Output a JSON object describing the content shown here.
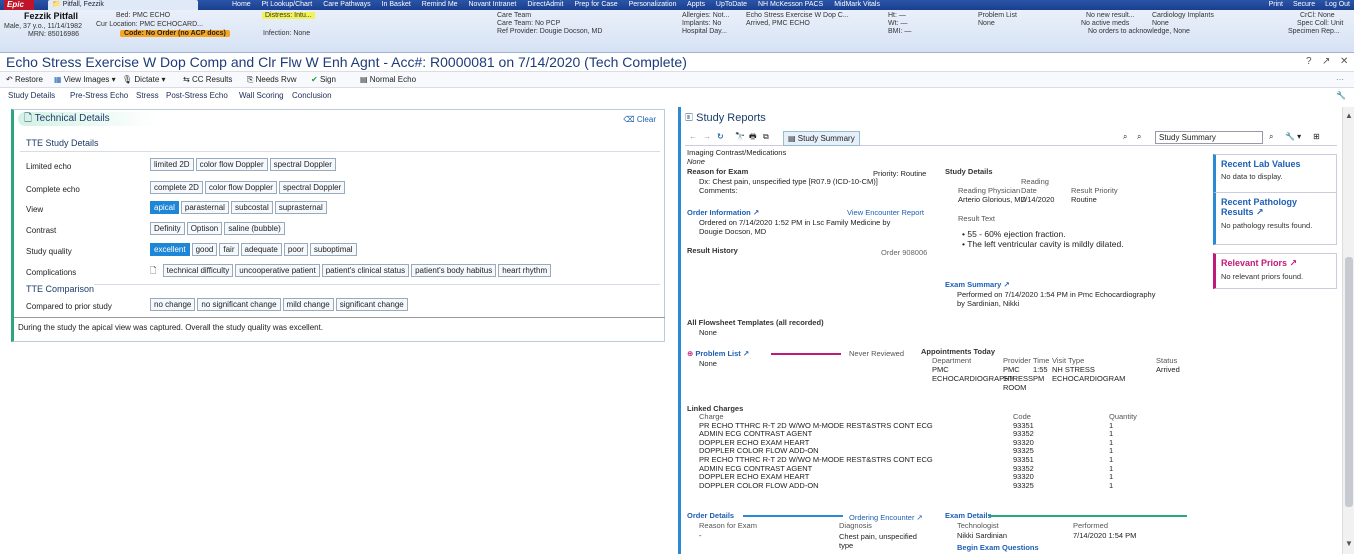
{
  "topbar": {
    "logo": "Epic",
    "patient_tab": "Pitfall, Fezzik",
    "menu": [
      "Home",
      "Pt Lookup/Chart",
      "Care Pathways",
      "In Basket",
      "Remind Me",
      "Novant Intranet",
      "DirectAdmit",
      "Prep for Case",
      "Personalization",
      "Appts",
      "UpToDate",
      "NH McKesson PACS",
      "MidMark Vitals"
    ],
    "right": [
      "Print",
      "Secure",
      "Log Out"
    ]
  },
  "header": {
    "name": "Fezzik Pitfall",
    "demo": "Male, 37 y.o., 11/14/1982",
    "mrn": "MRN: 85016986",
    "bed": "Bed: PMC ECHO",
    "cur_location": "Cur Location: PMC ECHOCARD...",
    "code": "Code: No Order (no ACP docs)",
    "distress": "Distress: Intu...",
    "infection": "Infection: None",
    "care_team": "Care Team",
    "care_team_val": "Care Team: No PCP",
    "ref_provider": "Ref Provider: Dougie Docson, MD",
    "allergies": "Allergies: Not...",
    "implants": "Implants: No",
    "hospital_day": "Hospital Day...",
    "order_desc": "Echo Stress Exercise W Dop C...",
    "arrived": "Arrived, PMC ECHO",
    "ht": "Ht: —",
    "wt": "Wt: —",
    "bmi": "BMI: —",
    "problem_list": "Problem List",
    "problem_val": "None",
    "no_new_result": "No new result...",
    "no_active_meds": "No active meds",
    "cardiology_implants": "Cardiology Implants",
    "ci_val": "None",
    "no_orders": "No orders to acknowledge, None",
    "crcl": "CrCl: None",
    "spec_coll": "Spec Coll: Unit",
    "specimen_rep": "Specimen Rep..."
  },
  "title": "Echo Stress Exercise W Dop Comp and Clr Flw W Enh Agnt - Acc#: R0000081 on 7/14/2020 (Tech Complete)",
  "toolbar": {
    "restore": "Restore",
    "view_images": "View Images",
    "dictate": "Dictate",
    "cc_results": "CC Results",
    "needs_rvw": "Needs Rvw",
    "sign": "Sign",
    "normal_echo": "Normal Echo"
  },
  "section_nav": [
    "Study Details",
    "Pre-Stress Echo",
    "Stress",
    "Post-Stress Echo",
    "Wall Scoring",
    "Conclusion"
  ],
  "tech": {
    "title": "Technical Details",
    "clear": "Clear",
    "tte_title": "TTE Study Details",
    "rows": [
      {
        "label": "Limited echo",
        "chips": [
          "limited 2D",
          "color flow Doppler",
          "spectral Doppler"
        ],
        "selected": []
      },
      {
        "label": "Complete echo",
        "chips": [
          "complete 2D",
          "color flow Doppler",
          "spectral Doppler"
        ],
        "selected": []
      },
      {
        "label": "View",
        "chips": [
          "apical",
          "parasternal",
          "subcostal",
          "suprasternal"
        ],
        "selected": [
          0
        ]
      },
      {
        "label": "Contrast",
        "chips": [
          "Definity",
          "Optison",
          "saline (bubble)"
        ],
        "selected": []
      },
      {
        "label": "Study quality",
        "chips": [
          "excellent",
          "good",
          "fair",
          "adequate",
          "poor",
          "suboptimal"
        ],
        "selected": [
          0
        ]
      },
      {
        "label": "Complications",
        "chips": [
          "technical difficulty",
          "uncooperative patient",
          "patient's clinical status",
          "patient's body habitus",
          "heart rhythm"
        ],
        "selected": []
      }
    ],
    "comparison_title": "TTE Comparison",
    "comparison_label": "Compared to prior study",
    "comparison_chips": [
      "no change",
      "no significant change",
      "mild change",
      "significant change"
    ],
    "summary": "During the study the apical view was captured. Overall the study quality was excellent."
  },
  "reports": {
    "title": "Study Reports",
    "summary_btn": "Study Summary",
    "search_value": "Study Summary",
    "imaging_contrast": "Imaging Contrast/Medications",
    "imaging_none": "None",
    "reason_title": "Reason for Exam",
    "priority": "Priority: Routine",
    "dx": "Dx: Chest pain, unspecified type [R07.9 (ICD-10-CM)]",
    "comments": "Comments:",
    "order_info": "Order Information",
    "view_encounter": "View Encounter Report",
    "ordered_on": "Ordered on 7/14/2020  1:52 PM in Lsc Family Medicine by",
    "ordered_by": "Dougie Docson, MD",
    "result_history": "Result History",
    "order_num": "Order 908006",
    "study_details": "Study Details",
    "reading_physician_h": "Reading Physician",
    "reading_date_h1": "Reading",
    "reading_date_h2": "Date",
    "result_priority_h": "Result Priority",
    "reading_physician": "Arterio Glorious, MD",
    "reading_date": "7/14/2020",
    "result_priority": "Routine",
    "result_text": "Result Text",
    "bullet1": "55 - 60% ejection fraction.",
    "bullet2": "The left ventricular cavity is mildly dilated.",
    "exam_summary": "Exam Summary",
    "performed": "Performed on 7/14/2020  1:54 PM in Pmc Echocardiography",
    "performed_by": "by Sardinian, Nikki",
    "flowsheet": "All Flowsheet Templates (all recorded)",
    "flowsheet_none": "None",
    "problem_list": "Problem List",
    "never_reviewed": "Never Reviewed",
    "problem_none": "None",
    "appointments": "Appointments Today",
    "appt_headers": [
      "Department",
      "Provider",
      "Time",
      "Visit Type",
      "Status"
    ],
    "appt_row": [
      "PMC",
      "PMC",
      "1:55",
      "NH STRESS",
      "Arrived"
    ],
    "appt_row2": [
      "ECHOCARDIOGRAPHY",
      "STRESS",
      "PM",
      "ECHOCARDIOGRAM",
      ""
    ],
    "appt_row3": [
      "",
      "ROOM",
      "",
      "",
      ""
    ],
    "linked_charges": "Linked Charges",
    "charge_headers": [
      "Charge",
      "Code",
      "Quantity"
    ],
    "charges": [
      [
        "PR ECHO TTHRC R-T 2D W/WO M-MODE REST&STRS CONT ECG",
        "93351",
        "1"
      ],
      [
        "ADMIN ECG CONTRAST AGENT",
        "93352",
        "1"
      ],
      [
        "DOPPLER ECHO EXAM HEART",
        "93320",
        "1"
      ],
      [
        "DOPPLER COLOR FLOW ADD-ON",
        "93325",
        "1"
      ],
      [
        "PR ECHO TTHRC R-T 2D W/WO M-MODE REST&STRS CONT ECG",
        "93351",
        "1"
      ],
      [
        "ADMIN ECG CONTRAST AGENT",
        "93352",
        "1"
      ],
      [
        "DOPPLER ECHO EXAM HEART",
        "93320",
        "1"
      ],
      [
        "DOPPLER COLOR FLOW ADD-ON",
        "93325",
        "1"
      ]
    ],
    "order_details": "Order Details",
    "ordering_encounter": "Ordering Encounter",
    "od_headers": [
      "Reason for Exam",
      "Diagnosis"
    ],
    "od_reason": "-",
    "od_diag1": "Chest pain, unspecified",
    "od_diag2": "type",
    "exam_details": "Exam Details",
    "ed_headers": [
      "Technologist",
      "Performed"
    ],
    "technologist": "Nikki Sardinian",
    "performed_time": "7/14/2020  1:54 PM",
    "begin_exam": "Begin Exam Questions",
    "cards": [
      {
        "title": "Recent Lab Values",
        "body": "No data to display.",
        "color": "#2a8ad6"
      },
      {
        "title": "Recent Pathology Results",
        "body": "No pathology results found.",
        "color": "#2a8ad6"
      },
      {
        "title": "Relevant Priors",
        "body": "No relevant priors found.",
        "color": "#c2187a"
      }
    ]
  }
}
